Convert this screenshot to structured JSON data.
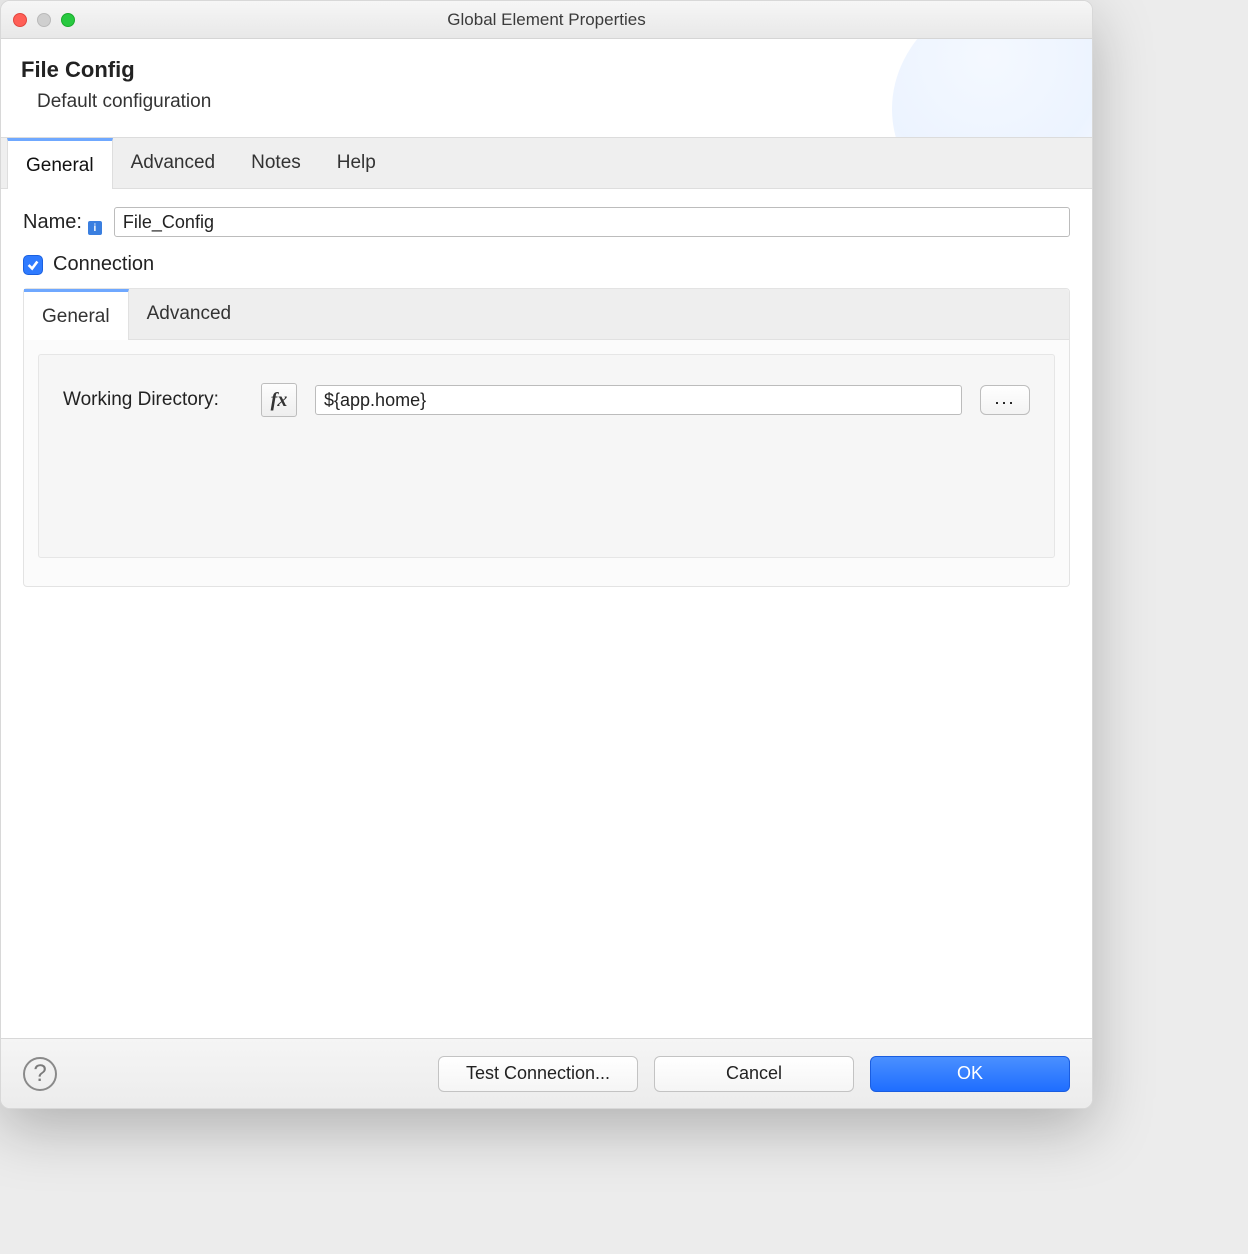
{
  "window": {
    "title": "Global Element Properties"
  },
  "header": {
    "title": "File Config",
    "subtitle": "Default configuration"
  },
  "tabs": {
    "items": [
      {
        "label": "General"
      },
      {
        "label": "Advanced"
      },
      {
        "label": "Notes"
      },
      {
        "label": "Help"
      }
    ],
    "active_index": 0
  },
  "general": {
    "name_label": "Name:",
    "name_value": "File_Config",
    "connection_label": "Connection",
    "connection_checked": true,
    "inner_tabs": {
      "items": [
        {
          "label": "General"
        },
        {
          "label": "Advanced"
        }
      ],
      "active_index": 0
    },
    "working_dir": {
      "label": "Working Directory:",
      "fx_symbol": "fx",
      "value": "${app.home}",
      "browse_label": "..."
    }
  },
  "footer": {
    "test_label": "Test Connection...",
    "cancel_label": "Cancel",
    "ok_label": "OK"
  }
}
